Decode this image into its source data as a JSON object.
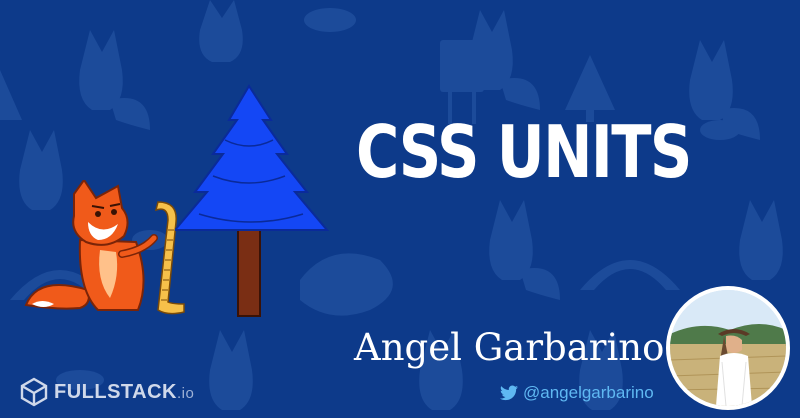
{
  "headline": "CSS UNITS",
  "author": {
    "name": "Angel Garbarino",
    "twitter_handle": "@angelgarbarino"
  },
  "brand": {
    "name": "FULLSTACK",
    "tld": ".io"
  },
  "icons": {
    "twitter": "twitter-bird-icon",
    "logo": "fullstack-cube-icon",
    "fox": "fox-with-ruler-icon",
    "tree": "pine-tree-icon",
    "avatar": "author-photo"
  },
  "colors": {
    "background": "#0d3a8a",
    "pattern": "#2a5aa8",
    "headline": "#ffffff",
    "twitter": "#5fb8f2",
    "fox": "#f05a1a",
    "tree": "#1447f5",
    "trunk": "#7a2e14"
  }
}
